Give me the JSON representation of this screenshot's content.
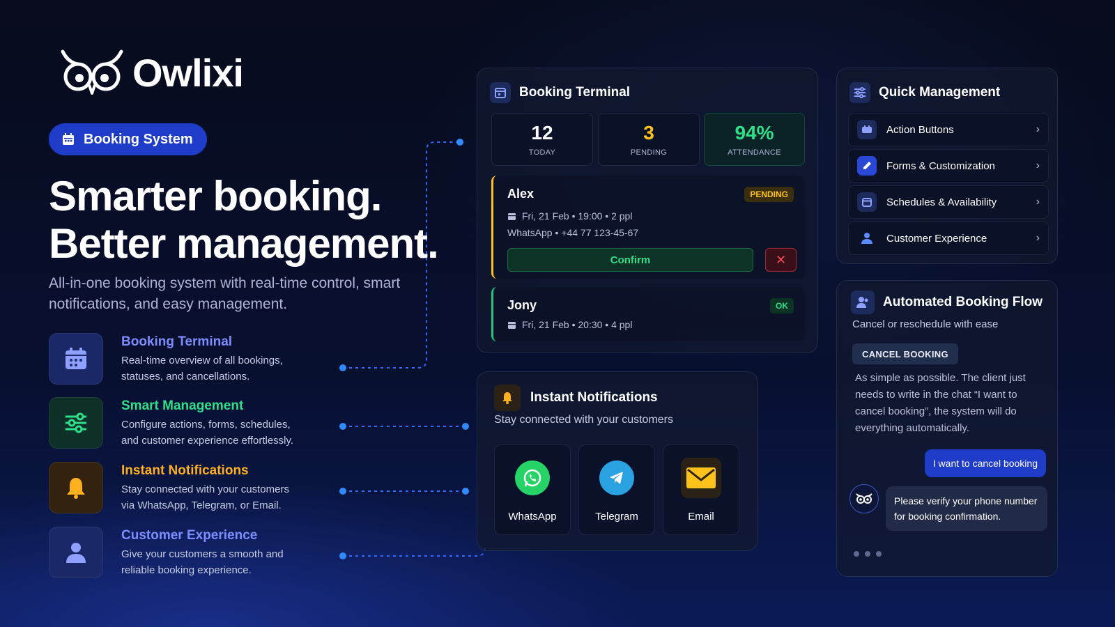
{
  "brand": {
    "name": "Owlixi"
  },
  "hero": {
    "pill_label": "Booking System",
    "headline_line1": "Smarter booking.",
    "headline_line2": "Better management.",
    "subhead": "All-in-one booking system with real-time control, smart notifications, and easy management."
  },
  "features": [
    {
      "title": "Booking Terminal",
      "desc_line1": "Real-time overview of all bookings,",
      "desc_line2": "statuses, and cancellations.",
      "color": "#7f8cff",
      "icon": "calendar-icon"
    },
    {
      "title": "Smart Management",
      "desc_line1": "Configure actions, forms, schedules,",
      "desc_line2": "and customer experience effortlessly.",
      "color": "#2fe08a",
      "icon": "sliders-icon"
    },
    {
      "title": "Instant Notifications",
      "desc_line1": "Stay connected with your customers",
      "desc_line2": "via WhatsApp, Telegram, or Email.",
      "color": "#ffb020",
      "icon": "bell-icon"
    },
    {
      "title": "Customer Experience",
      "desc_line1": "Give your customers a smooth and",
      "desc_line2": "reliable booking experience.",
      "color": "#7f8cff",
      "icon": "user-icon"
    }
  ],
  "booking_terminal": {
    "title": "Booking Terminal",
    "stats": [
      {
        "value": "12",
        "label": "TODAY",
        "color": "#ffffff"
      },
      {
        "value": "3",
        "label": "PENDING",
        "color": "#ffc21a"
      },
      {
        "value": "94%",
        "label": "ATTENDANCE",
        "color": "#2fe08a"
      }
    ],
    "bookings": [
      {
        "name": "Alex",
        "status": "PENDING",
        "when": "Fri, 21 Feb • 19:00 • 2 ppl",
        "contact": "WhatsApp • +44 77 123-45-67",
        "confirm_label": "Confirm",
        "reject_label": "✕",
        "accent": "#ffc21a"
      },
      {
        "name": "Jony",
        "status": "OK",
        "when": "Fri, 21 Feb • 20:30 • 4 ppl",
        "accent": "#22c37a"
      }
    ]
  },
  "notifications": {
    "title": "Instant Notifications",
    "subtitle": "Stay connected with your customers",
    "channels": [
      {
        "label": "WhatsApp",
        "icon": "whatsapp-icon",
        "color": "#25d366"
      },
      {
        "label": "Telegram",
        "icon": "telegram-icon",
        "color": "#2aa1e0"
      },
      {
        "label": "Email",
        "icon": "envelope-icon",
        "color": "#ffc21a"
      }
    ]
  },
  "quick_management": {
    "title": "Quick Management",
    "items": [
      {
        "label": "Action Buttons",
        "icon": "tag-icon"
      },
      {
        "label": "Forms & Customization",
        "icon": "edit-icon"
      },
      {
        "label": "Schedules & Availability",
        "icon": "calendar-icon"
      },
      {
        "label": "Customer Experience",
        "icon": "user-icon"
      }
    ]
  },
  "automated_flow": {
    "title": "Automated Booking Flow",
    "subtitle": "Cancel or reschedule with ease",
    "tag": "CANCEL BOOKING",
    "description": "As simple as possible. The client just needs to write in the chat “I want to cancel booking”, the system will do everything automatically.",
    "user_message": "I want to cancel booking",
    "bot_message": "Please verify your phone number for booking confirmation."
  }
}
